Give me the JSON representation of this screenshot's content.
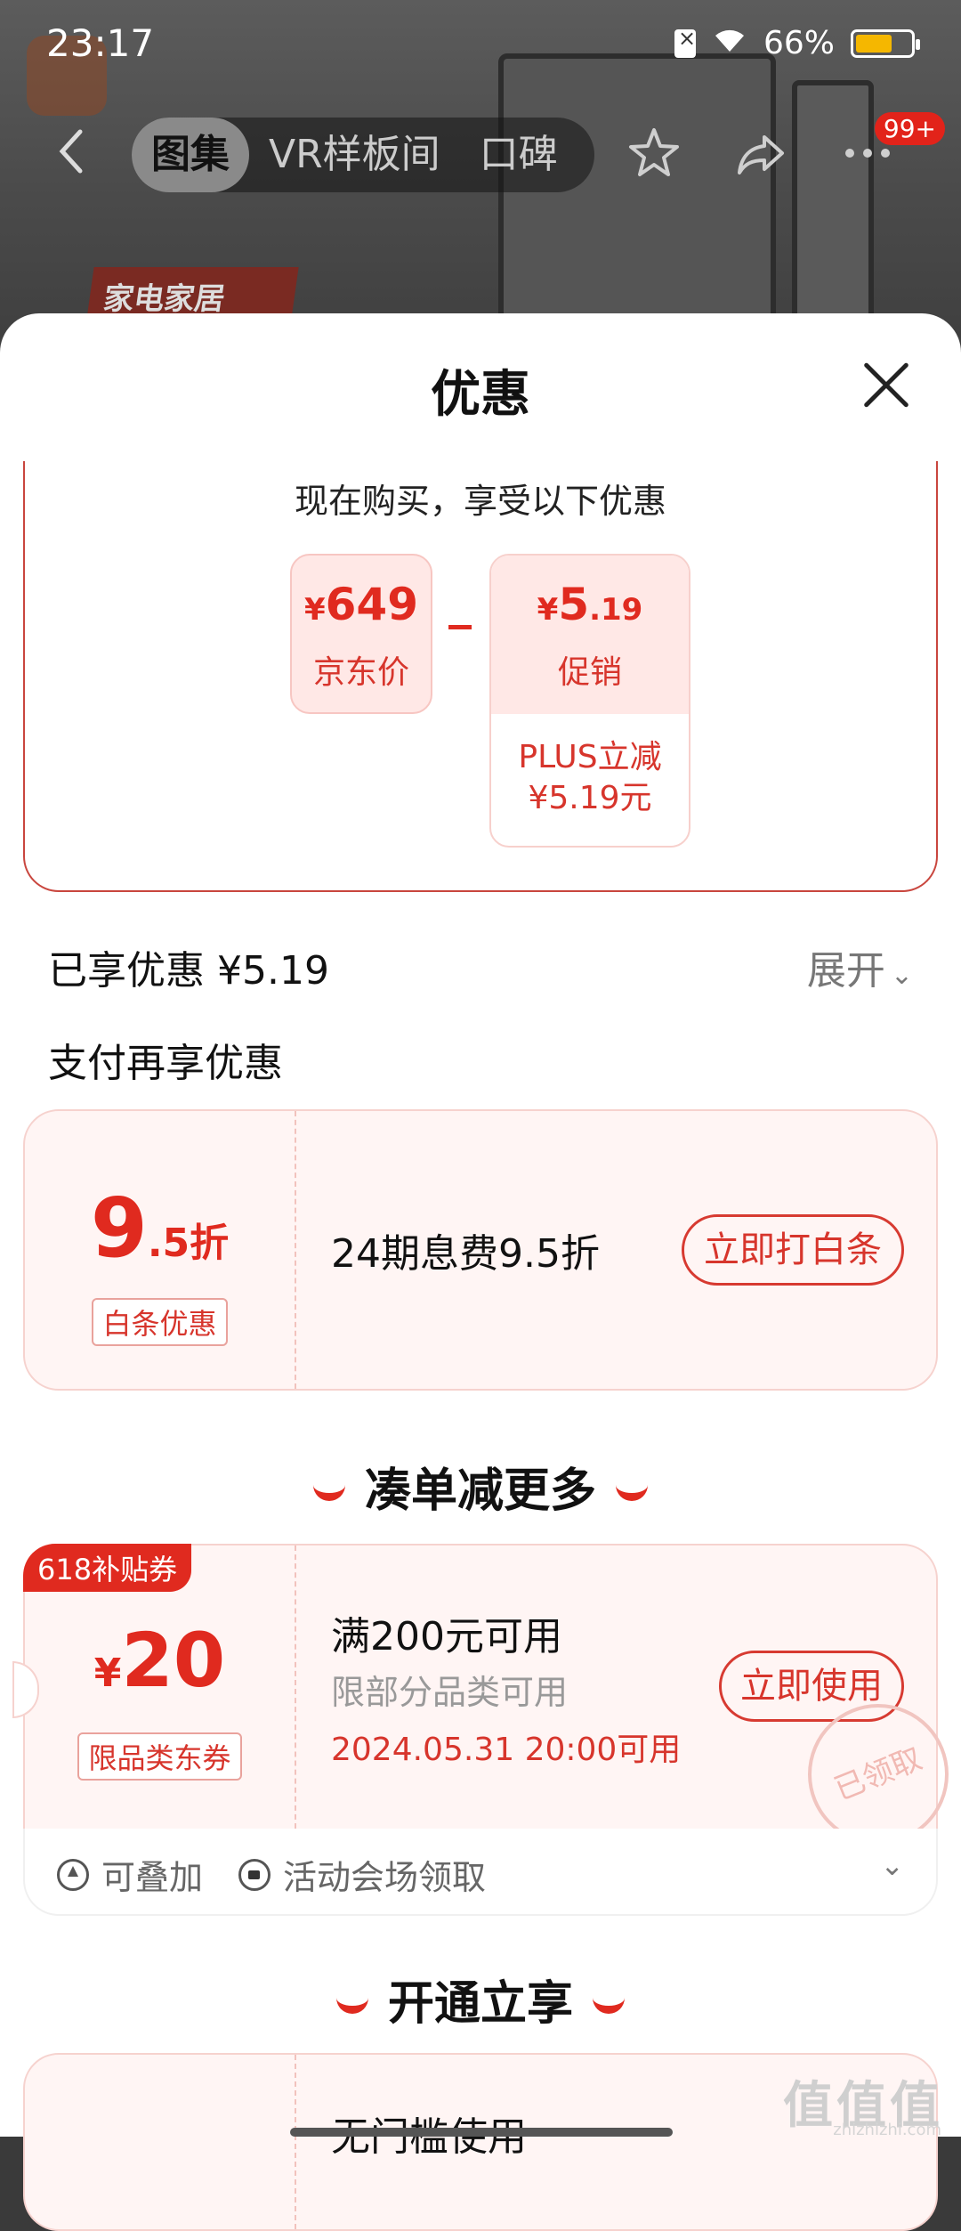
{
  "status_bar": {
    "time": "23:17",
    "battery": "66%",
    "battery_level": 0.66
  },
  "nav": {
    "tabs": [
      "图集",
      "VR样板间",
      "口碑"
    ],
    "active_tab": 0,
    "cart_badge": "99+",
    "bg_banner": "家电家居"
  },
  "sheet": {
    "title": "优惠",
    "intro": "现在购买，享受以下优惠",
    "jd_price": {
      "currency": "¥",
      "value": "649",
      "label": "京东价"
    },
    "promo": {
      "currency": "¥",
      "int": "5",
      "dec": ".19",
      "label": "促销",
      "detail_line1": "PLUS立减",
      "detail_line2": "¥5.19元"
    },
    "enjoyed": "已享优惠 ¥5.19",
    "expand": "展开",
    "pay_more": "支付再享优惠",
    "baitiao": {
      "big": "9",
      "small": ".5折",
      "tag": "白条优惠",
      "desc": "24期息费9.5折",
      "button": "立即打白条"
    },
    "section_more": "凑单减更多",
    "voucher": {
      "ribbon": "618补贴券",
      "currency": "¥",
      "value": "20",
      "tag": "限品类东券",
      "title": "满200元可用",
      "subtitle": "限部分品类可用",
      "date": "2024.05.31 20:00可用",
      "button": "立即使用",
      "stamp": "已领取",
      "stackable": "可叠加",
      "source": "活动会场领取"
    },
    "section_open": "开通立享",
    "next_card_text": "无门槛使用"
  },
  "watermark": {
    "main": "值值值",
    "sub": "zhizhizhi.com"
  },
  "colors": {
    "accent": "#e02a1f",
    "card_bg": "#fff5f4"
  }
}
